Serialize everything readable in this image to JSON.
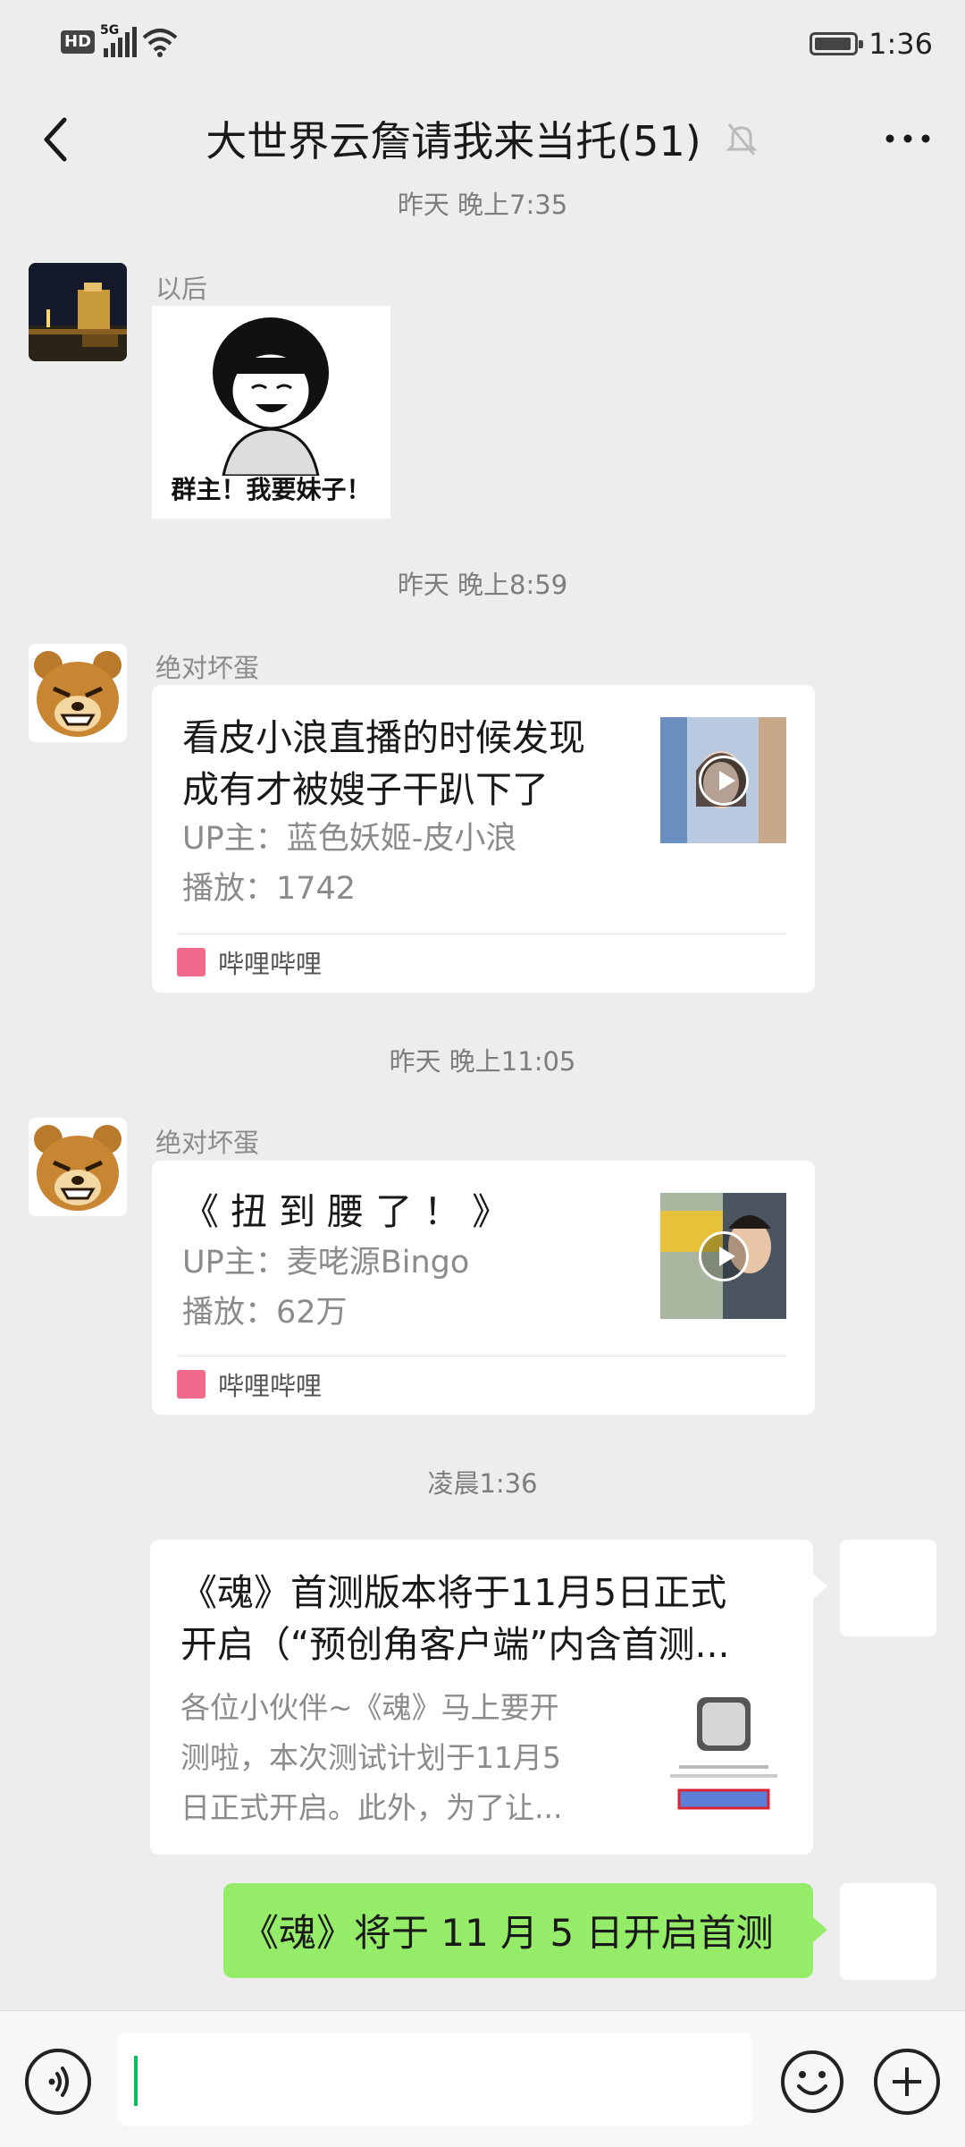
{
  "status_bar": {
    "hd": "HD",
    "network": "5G",
    "wifi_tag": "6",
    "time": "1:36"
  },
  "header": {
    "title": "大世界云詹请我来当托(51)"
  },
  "messages": [
    {
      "timestamp": "昨天 晚上7:35",
      "sender": "以后",
      "sticker_caption": "群主！我要妹子！"
    },
    {
      "timestamp": "昨天 晚上8:59",
      "sender": "绝对坏蛋",
      "card": {
        "title_line1": "看皮小浪直播的时候发现",
        "title_line2": "成有才被嫂子干趴下了",
        "uploader": "UP主：蓝色妖姬-皮小浪",
        "plays": "播放：1742",
        "source": "哔哩哔哩"
      }
    },
    {
      "timestamp": "昨天 晚上11:05",
      "sender": "绝对坏蛋",
      "card": {
        "title_line1": "《 扭 到 腰 了 ！ 》",
        "uploader": "UP主：麦咾源Bingo",
        "plays": "播放：62万",
        "source": "哔哩哔哩"
      }
    },
    {
      "timestamp": "凌晨1:36",
      "self_card": {
        "title_line1": "《魂》首测版本将于11月5日正式",
        "title_line2": "开启（“预创角客户端”内含首测...",
        "desc_line1": "各位小伙伴~《魂》马上要开",
        "desc_line2": "测啦，本次测试计划于11月5",
        "desc_line3": "日正式开启。此外，为了让..."
      },
      "self_text": "《魂》将于 11 月 5 日开启首测"
    }
  ]
}
